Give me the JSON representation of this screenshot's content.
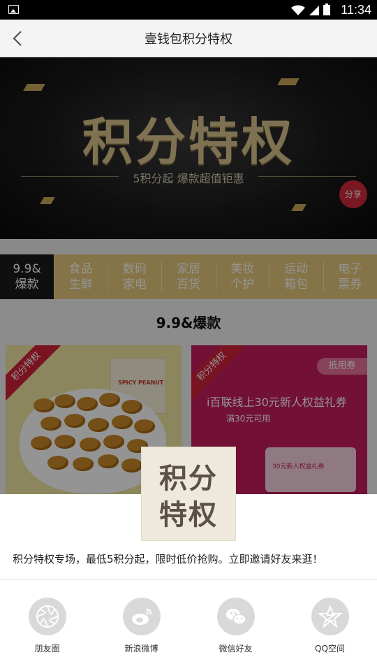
{
  "status_bar": {
    "time": "11:34"
  },
  "header": {
    "title": "壹钱包积分特权",
    "back_icon": "chevron-left-icon"
  },
  "banner": {
    "headline": "积分特权",
    "subline": "5积分起  爆款超值钜惠",
    "share_label": "分享"
  },
  "tabs": [
    {
      "line1": "9.9&",
      "line2": "爆款",
      "active": true
    },
    {
      "line1": "食品",
      "line2": "生鲜",
      "active": false
    },
    {
      "line1": "数码",
      "line2": "家电",
      "active": false
    },
    {
      "line1": "家居",
      "line2": "百货",
      "active": false
    },
    {
      "line1": "美妆",
      "line2": "个护",
      "active": false
    },
    {
      "line1": "运动",
      "line2": "箱包",
      "active": false
    },
    {
      "line1": "电子",
      "line2": "票券",
      "active": false
    }
  ],
  "section": {
    "title": "9.9&爆款"
  },
  "products": [
    {
      "ribbon": "积分特权",
      "packet_text": "SPICY PEANUT"
    },
    {
      "ribbon": "积分特权",
      "tag": "抵用券",
      "title": "i百联线上30元新人权益礼券",
      "subtitle": "满30元可用",
      "mini_coupon_text": "30元新人权益礼券"
    }
  ],
  "share_sheet": {
    "thumbnail_line1": "积分",
    "thumbnail_line2": "特权",
    "description": "积分特权专场，最低5积分起，限时低价抢购。立即邀请好友来逛！",
    "targets": [
      {
        "label": "朋友圈",
        "icon": "moments-icon"
      },
      {
        "label": "新浪微博",
        "icon": "weibo-icon"
      },
      {
        "label": "微信好友",
        "icon": "wechat-icon"
      },
      {
        "label": "QQ空间",
        "icon": "qzone-icon"
      }
    ]
  }
}
